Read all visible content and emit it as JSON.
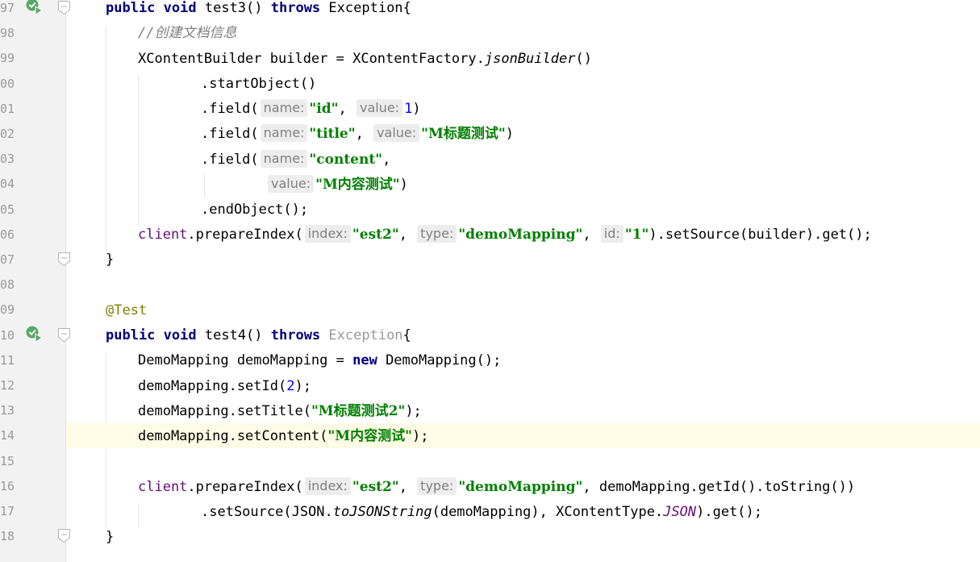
{
  "editor": {
    "lines": [
      {
        "num": "97",
        "icon": "run",
        "fold": true
      },
      {
        "num": "98"
      },
      {
        "num": "99"
      },
      {
        "num": "00"
      },
      {
        "num": "01"
      },
      {
        "num": "02"
      },
      {
        "num": "03"
      },
      {
        "num": "04"
      },
      {
        "num": "05"
      },
      {
        "num": "06"
      },
      {
        "num": "07",
        "fold": true
      },
      {
        "num": "08"
      },
      {
        "num": "09"
      },
      {
        "num": "10",
        "icon": "run",
        "fold": true
      },
      {
        "num": "11"
      },
      {
        "num": "12"
      },
      {
        "num": "13"
      },
      {
        "num": "14",
        "current": true
      },
      {
        "num": "15"
      },
      {
        "num": "16"
      },
      {
        "num": "17"
      },
      {
        "num": "18",
        "fold": true
      }
    ],
    "t": {
      "public": "public",
      "void": "void",
      "throws": "throws",
      "new": "new",
      "exception": "Exception",
      "test3": " test3() ",
      "test4": " test4() ",
      "brace_open": "{",
      "brace_close": "}",
      "comment": "//创建文档信息",
      "xcb_decl": "XContentBuilder builder = XContentFactory.",
      "jsonBuilder": "jsonBuilder",
      "parens": "()",
      "startObject": ".startObject()",
      "field_open": ".field(",
      "name_hint": "name:",
      "value_hint": "value:",
      "index_hint": "index:",
      "type_hint": "type:",
      "id_hint": "id:",
      "str_id": "\"id\"",
      "str_title": "\"title\"",
      "str_content": "\"content\"",
      "str_m_title": "\"M标题测试\"",
      "str_m_content": "\"M内容测试\"",
      "str_m_title2": "\"M标题测试2\"",
      "str_est2": "\"est2\"",
      "str_demoMapping": "\"demoMapping\"",
      "str_1": "\"1\"",
      "num_1": "1",
      "num_2": "2",
      "comma_sp": ", ",
      "comma": ",",
      "close_paren": ")",
      "endObject": ".endObject();",
      "client": "client",
      "prepareIndex": ".prepareIndex(",
      "setSource_builder": ").setSource(builder).get();",
      "annotation": "@Test",
      "demo_decl": "DemoMapping demoMapping = ",
      "demo_ctor": " DemoMapping();",
      "setId": "demoMapping.setId(",
      "stmt_end": ");",
      "setTitle": "demoMapping.setTitle(",
      "setContent": "demoMapping.setContent(",
      "getId_toString": ", demoMapping.getId().toString())",
      "setSource_json": ".setSource(JSON.",
      "toJSONString": "toJSONString",
      "demoMapping_arg": "(demoMapping), XContentType.",
      "JSON": "JSON",
      "get_end": ").get();"
    }
  }
}
